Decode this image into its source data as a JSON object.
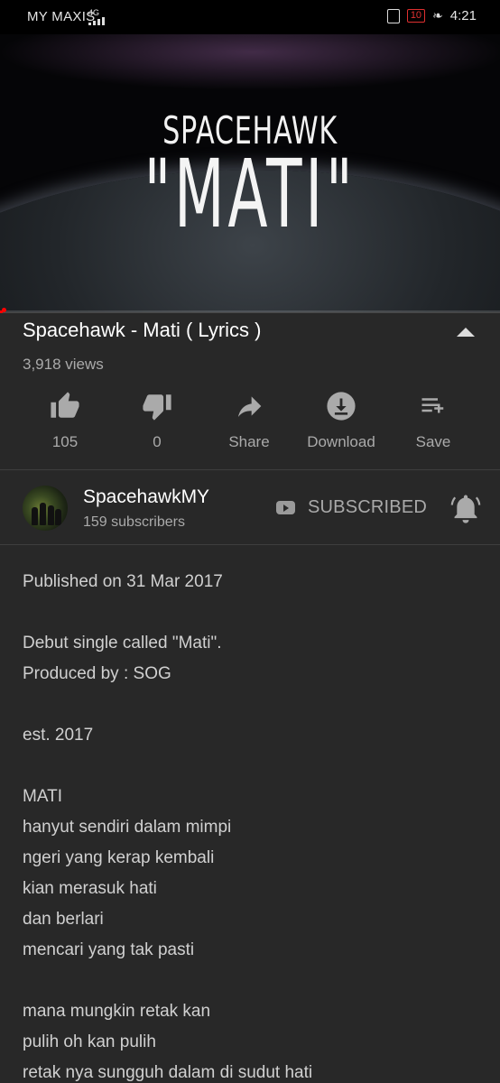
{
  "status_bar": {
    "carrier": "MY MAXIS",
    "network": "4G",
    "battery": "10",
    "time": "4:21"
  },
  "video": {
    "artist_text": "SPACEHAWK",
    "title_text": "\"MATI\"",
    "progress": 0.005
  },
  "details": {
    "title": "Spacehawk - Mati ( Lyrics )",
    "views": "3,918 views"
  },
  "actions": {
    "like_count": "105",
    "dislike_count": "0",
    "share_label": "Share",
    "download_label": "Download",
    "save_label": "Save"
  },
  "channel": {
    "name": "SpacehawkMY",
    "subscribers": "159 subscribers",
    "subscribe_label": "SUBSCRIBED"
  },
  "description": {
    "published": "Published on 31 Mar 2017",
    "line1": "Debut single called \"Mati\".",
    "line2": "Produced by : SOG",
    "line3": "est. 2017",
    "lyrics_1": [
      "MATI",
      "hanyut sendiri dalam mimpi",
      "ngeri yang kerap kembali",
      "kian merasuk hati",
      "dan berlari",
      "mencari yang tak pasti"
    ],
    "lyrics_2": [
      "mana mungkin retak kan",
      "pulih oh kan pulih",
      "retak nya sungguh dalam di sudut hati"
    ]
  },
  "icons": {
    "like": "thumb-up-icon",
    "dislike": "thumb-down-icon",
    "share": "share-arrow-icon",
    "download": "download-icon",
    "save": "playlist-add-icon",
    "bell": "notification-bell-icon",
    "youtube": "youtube-icon"
  },
  "colors": {
    "background": "#282828",
    "progress": "#ff0000",
    "secondary_text": "#aaaaaa"
  }
}
